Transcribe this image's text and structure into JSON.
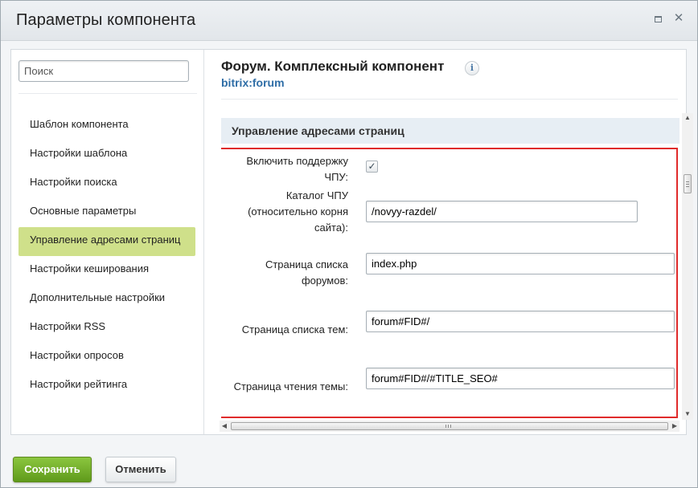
{
  "dialog": {
    "title": "Параметры компонента"
  },
  "sidebar": {
    "search_placeholder": "Поиск",
    "items": [
      {
        "label": "Шаблон компонента",
        "active": false
      },
      {
        "label": "Настройки шаблона",
        "active": false
      },
      {
        "label": "Настройки поиска",
        "active": false
      },
      {
        "label": "Основные параметры",
        "active": false
      },
      {
        "label": "Управление адресами страниц",
        "active": true
      },
      {
        "label": "Настройки кеширования",
        "active": false
      },
      {
        "label": "Дополнительные настройки",
        "active": false
      },
      {
        "label": "Настройки RSS",
        "active": false
      },
      {
        "label": "Настройки опросов",
        "active": false
      },
      {
        "label": "Настройки рейтинга",
        "active": false
      }
    ]
  },
  "main": {
    "component_title": "Форум. Комплексный компонент",
    "component_code": "bitrix:forum",
    "section_title": "Управление адресами страниц",
    "fields": {
      "sef_enable": {
        "label_line1": "Включить поддержку",
        "label_line2": "ЧПУ:",
        "checked": true
      },
      "sef_folder": {
        "label_line1": "Каталог ЧПУ",
        "label_line2": "(относительно корня",
        "label_line3": "сайта):",
        "value": "/novyy-razdel/"
      },
      "forum_list": {
        "label_line1": "Страница списка",
        "label_line2": "форумов:",
        "value": "index.php"
      },
      "topic_list": {
        "label": "Страница списка тем:",
        "value": "forum#FID#/"
      },
      "topic_read": {
        "label": "Страница чтения темы:",
        "value": "forum#FID#/#TITLE_SEO#"
      }
    }
  },
  "footer": {
    "save_label": "Сохранить",
    "cancel_label": "Отменить"
  },
  "colors": {
    "active_nav": "#cfe08a",
    "save_button": "#6fae27",
    "highlight_border": "#e02b2b",
    "link_blue": "#2e6da6"
  }
}
